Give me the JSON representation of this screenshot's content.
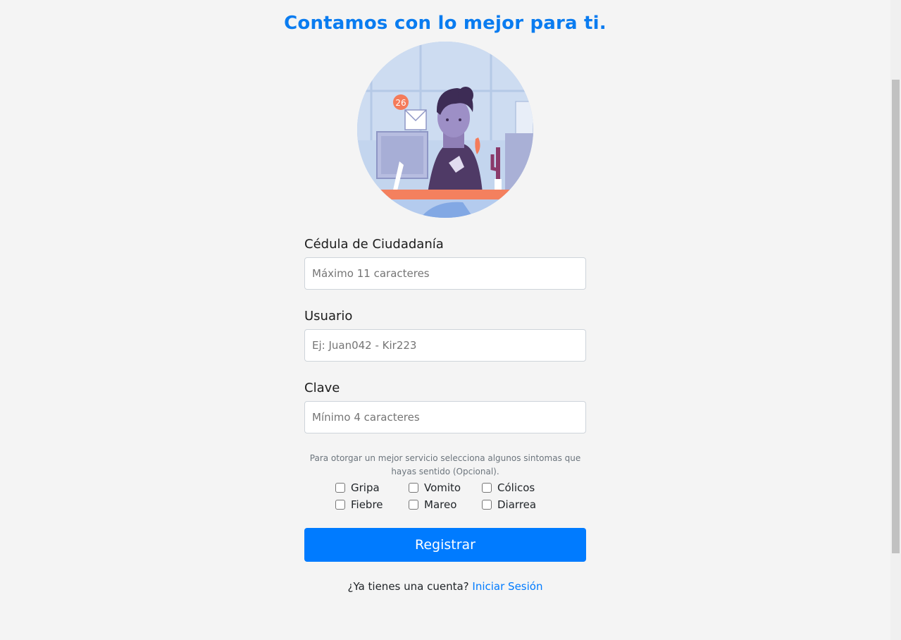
{
  "header": {
    "title": "Contamos con lo mejor para ti."
  },
  "illustration": {
    "badge_count": "26"
  },
  "form": {
    "cedula": {
      "label": "Cédula de Ciudadanía",
      "placeholder": "Máximo 11 caracteres",
      "value": ""
    },
    "usuario": {
      "label": "Usuario",
      "placeholder": "Ej: Juan042 - Kir223",
      "value": ""
    },
    "clave": {
      "label": "Clave",
      "placeholder": "Mínimo 4 caracteres",
      "value": ""
    },
    "symptoms_hint": "Para otorgar un mejor servicio selecciona algunos sintomas que hayas sentido (Opcional).",
    "symptoms": [
      {
        "label": "Gripa",
        "checked": false
      },
      {
        "label": "Vomito",
        "checked": false
      },
      {
        "label": "Cólicos",
        "checked": false
      },
      {
        "label": "Fiebre",
        "checked": false
      },
      {
        "label": "Mareo",
        "checked": false
      },
      {
        "label": "Diarrea",
        "checked": false
      }
    ],
    "submit_label": "Registrar"
  },
  "footer": {
    "prompt": "¿Ya tienes una cuenta?",
    "link_label": "Iniciar Sesión"
  },
  "colors": {
    "accent": "#007bff",
    "title": "#0a7cf0",
    "background": "#f4f4f4"
  }
}
